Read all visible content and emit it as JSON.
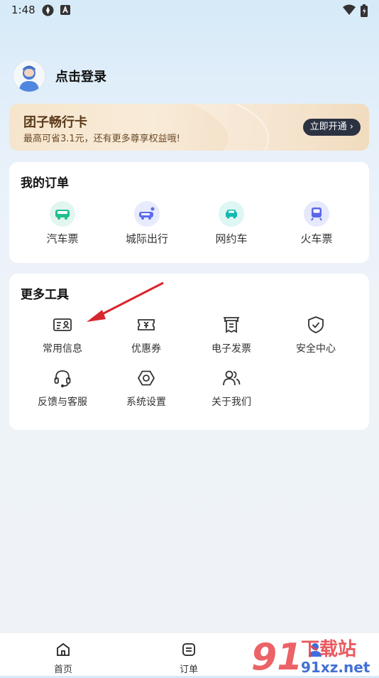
{
  "status_bar": {
    "time": "1:48"
  },
  "profile": {
    "login_label": "点击登录"
  },
  "member_card": {
    "title": "团子畅行卡",
    "subtitle": "最高可省3.1元，还有更多尊享权益哦!",
    "button_label": "立即开通"
  },
  "orders": {
    "title": "我的订单",
    "items": [
      {
        "label": "汽车票",
        "icon": "bus-icon",
        "color": "#1fbf8f"
      },
      {
        "label": "城际出行",
        "icon": "intercity-van-icon",
        "color": "#5b6cf0"
      },
      {
        "label": "网约车",
        "icon": "car-icon",
        "color": "#13b9b0"
      },
      {
        "label": "火车票",
        "icon": "train-icon",
        "color": "#5866e8"
      }
    ]
  },
  "tools": {
    "title": "更多工具",
    "items": [
      {
        "label": "常用信息",
        "icon": "id-card-icon"
      },
      {
        "label": "优惠券",
        "icon": "coupon-icon"
      },
      {
        "label": "电子发票",
        "icon": "invoice-icon"
      },
      {
        "label": "安全中心",
        "icon": "shield-check-icon"
      },
      {
        "label": "反馈与客服",
        "icon": "headset-icon"
      },
      {
        "label": "系统设置",
        "icon": "settings-icon"
      },
      {
        "label": "关于我们",
        "icon": "users-icon"
      }
    ]
  },
  "tabbar": {
    "items": [
      {
        "label": "首页",
        "icon": "home-icon"
      },
      {
        "label": "订单",
        "icon": "order-icon"
      }
    ]
  },
  "watermark": {
    "text": "下载站",
    "site": "91xz.net"
  }
}
